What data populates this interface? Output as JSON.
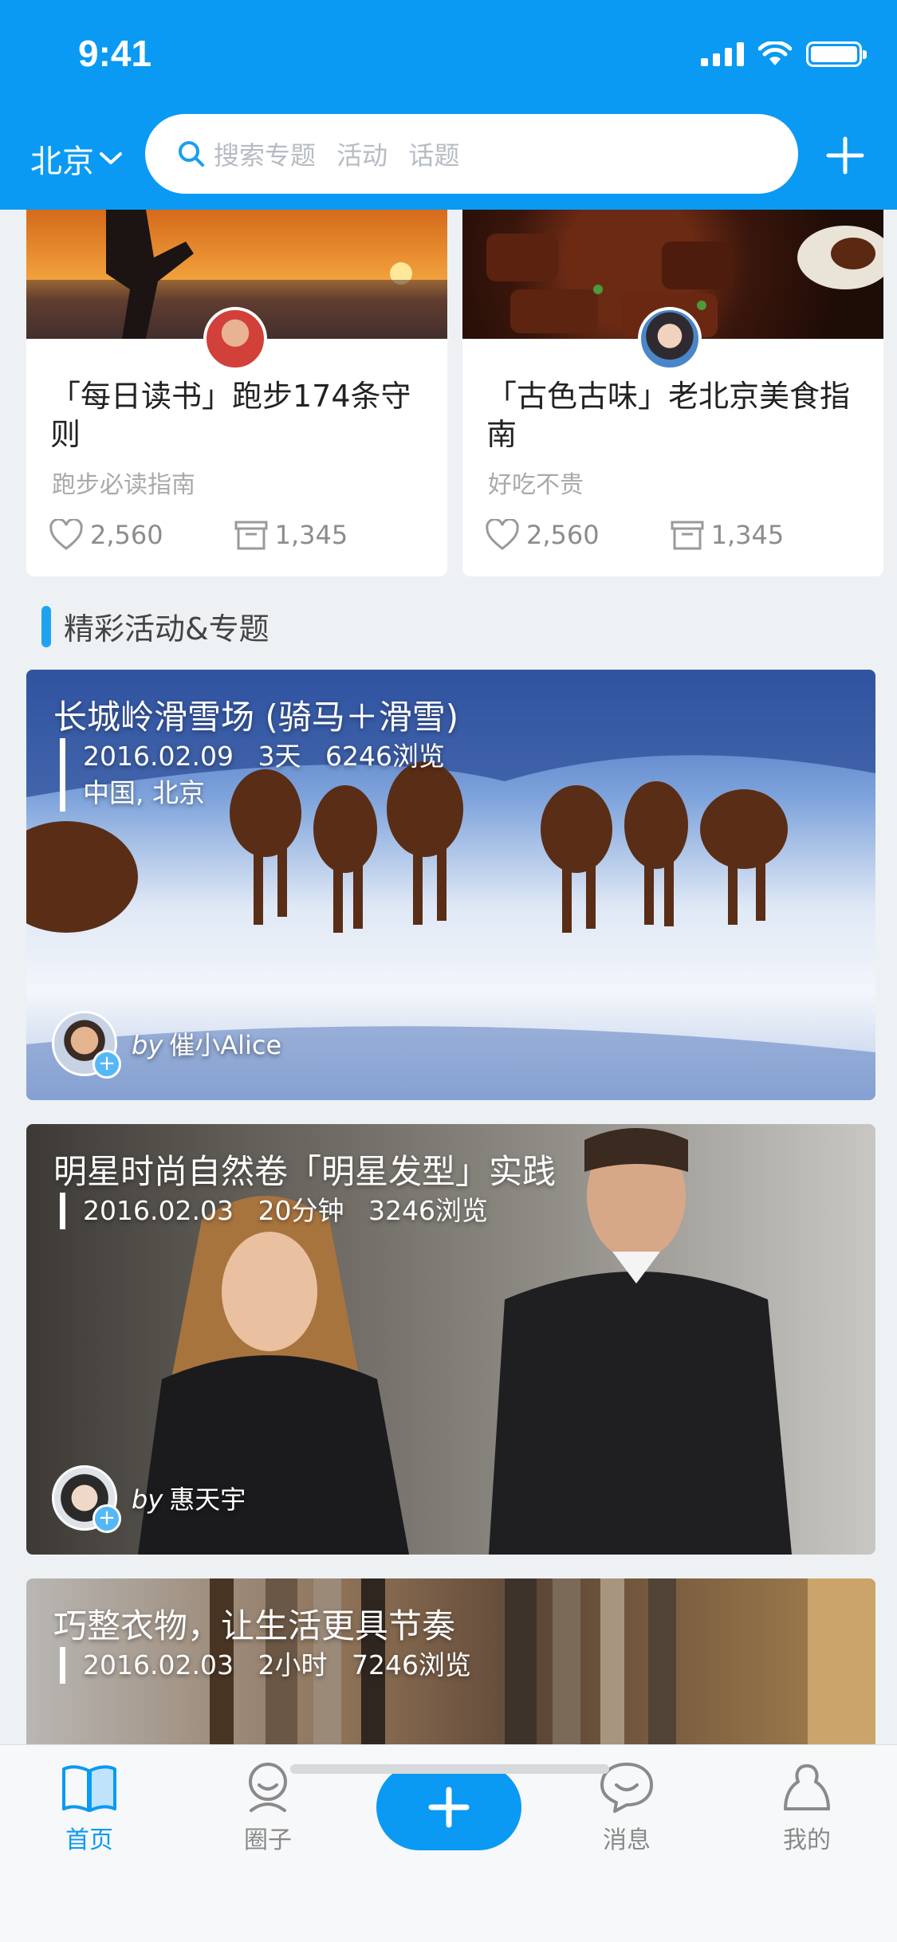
{
  "status": {
    "time": "9:41"
  },
  "header": {
    "city": "北京",
    "search_placeholder": "搜索专题 活动 话题"
  },
  "top_cards": [
    {
      "title": "「每日读书」跑步174条守则",
      "subtitle": "跑步必读指南",
      "likes": "2,560",
      "saves": "1,345"
    },
    {
      "title": "「古色古味」老北京美食指南",
      "subtitle": "好吃不贵",
      "likes": "2,560",
      "saves": "1,345"
    }
  ],
  "section": {
    "title": "精彩活动&专题"
  },
  "features": [
    {
      "title": "长城岭滑雪场 (骑马＋滑雪)",
      "date": "2016.02.09",
      "duration": "3天",
      "views": "6246浏览",
      "location": "中国, 北京",
      "by": "by",
      "author": "催小Alice"
    },
    {
      "title": "明星时尚自然卷「明星发型」实践",
      "date": "2016.02.03",
      "duration": "20分钟",
      "views": "3246浏览",
      "by": "by",
      "author": "惠天宇"
    },
    {
      "title": "巧整衣物，让生活更具节奏",
      "date": "2016.02.03",
      "duration": "2小时",
      "views": "7246浏览"
    }
  ],
  "tabbar": {
    "home": "首页",
    "circle": "圈子",
    "messages": "消息",
    "mine": "我的"
  }
}
